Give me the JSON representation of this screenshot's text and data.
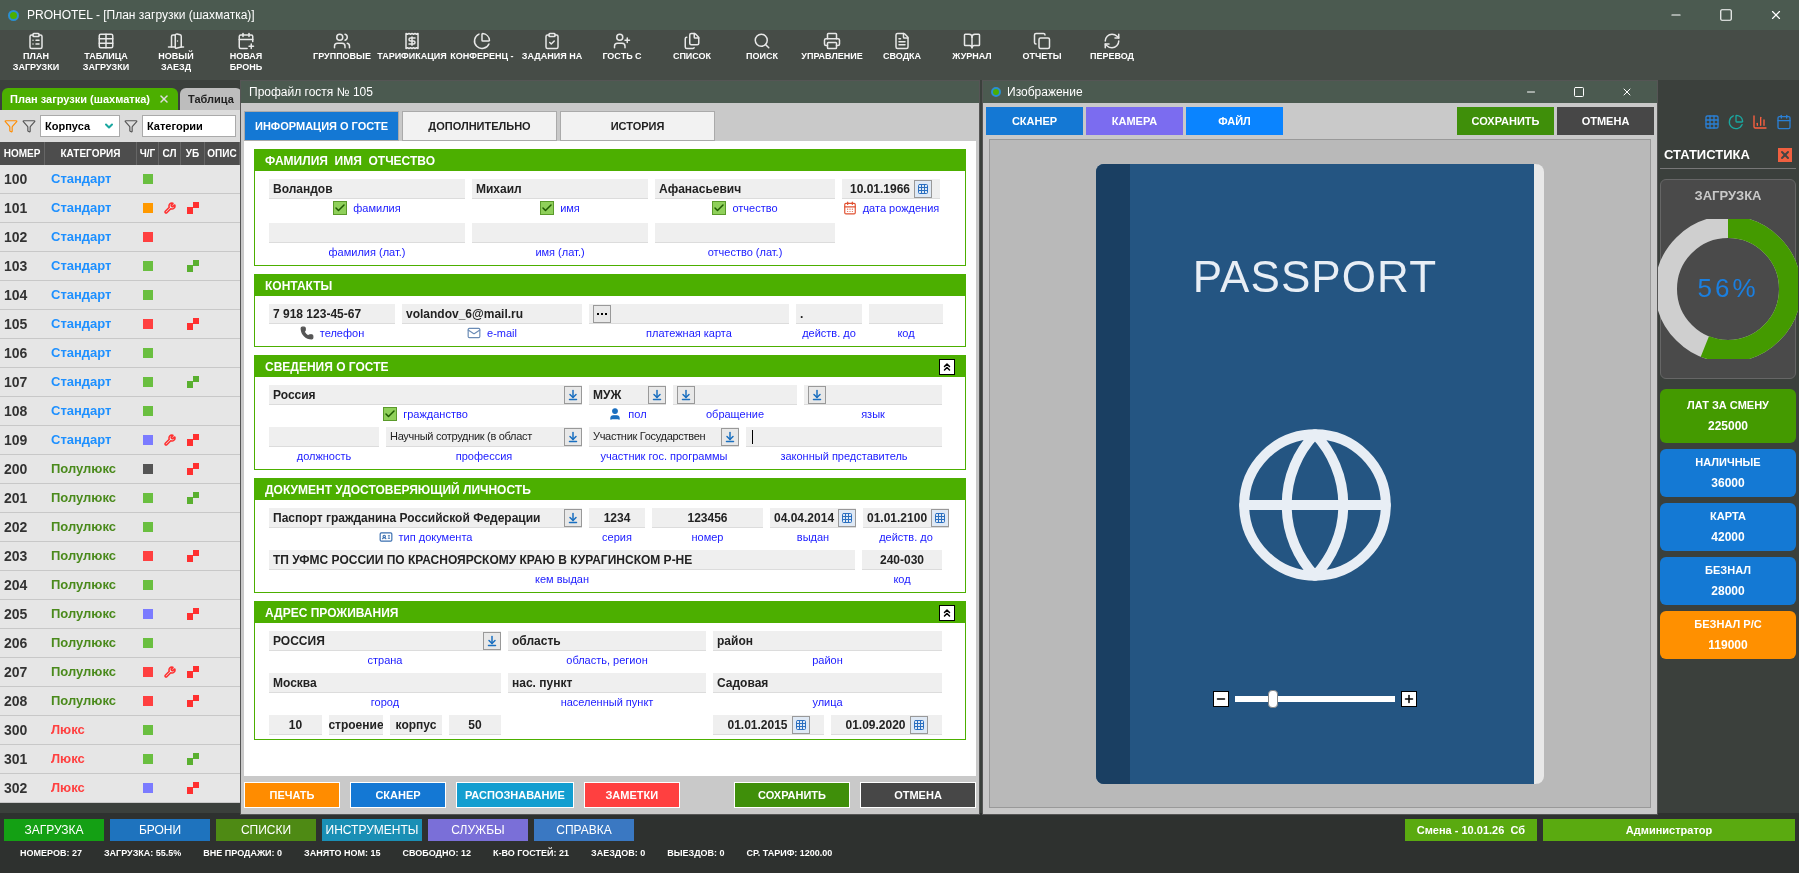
{
  "window": {
    "title": "PROHOTEL - [План загрузки (шахматка)]"
  },
  "toolbar": [
    {
      "lines": [
        "ПЛАН",
        "ЗАГРУЗКИ"
      ]
    },
    {
      "lines": [
        "ТАБЛИЦА",
        "ЗАГРУЗКИ"
      ]
    },
    {
      "lines": [
        "НОВЫЙ",
        "ЗАЕЗД"
      ]
    },
    {
      "lines": [
        "НОВАЯ",
        "БРОНЬ"
      ]
    },
    {
      "lines": [
        "ГРУППОВЫЕ"
      ]
    },
    {
      "lines": [
        "ТАРИФИКАЦИЯ"
      ]
    },
    {
      "lines": [
        "КОНФЕРЕНЦ -"
      ]
    },
    {
      "lines": [
        "ЗАДАНИЯ НА"
      ]
    },
    {
      "lines": [
        "ГОСТЬ С"
      ]
    },
    {
      "lines": [
        "СПИСОК"
      ]
    },
    {
      "lines": [
        "ПОИСК"
      ]
    },
    {
      "lines": [
        "УПРАВЛЕНИЕ"
      ]
    },
    {
      "lines": [
        "СВОДКА"
      ]
    },
    {
      "lines": [
        "ЖУРНАЛ"
      ]
    },
    {
      "lines": [
        "ОТЧЕТЫ"
      ]
    },
    {
      "lines": [
        "ПЕРЕВОД"
      ]
    }
  ],
  "main_tabs": [
    {
      "label": "План загрузки (шахматка)",
      "selected": true,
      "closable": true
    },
    {
      "label": "Таблица",
      "selected": false,
      "closable": false
    }
  ],
  "filters": [
    {
      "value": "Корпуса"
    },
    {
      "value": "Категории"
    }
  ],
  "table": {
    "columns": [
      "НОМЕР",
      "КАТЕГОРИЯ",
      "Ч/Г",
      "СЛ",
      "УБ",
      "ОПИС"
    ],
    "rows": [
      {
        "number": "100",
        "category": "Стандарт",
        "kind": "standard",
        "color": "#6abf40",
        "service": false
      },
      {
        "number": "101",
        "category": "Стандарт",
        "kind": "standard",
        "color": "#ff9900",
        "service": true,
        "cleaning": {
          "kind": "dirty"
        }
      },
      {
        "number": "102",
        "category": "Стандарт",
        "kind": "standard",
        "color": "#ff4040",
        "service": false
      },
      {
        "number": "103",
        "category": "Стандарт",
        "kind": "standard",
        "color": "#6abf40",
        "service": false,
        "cleaning": {
          "kind": "clean"
        }
      },
      {
        "number": "104",
        "category": "Стандарт",
        "kind": "standard",
        "color": "#6abf40",
        "service": false
      },
      {
        "number": "105",
        "category": "Стандарт",
        "kind": "standard",
        "color": "#ff4040",
        "service": false,
        "cleaning": {
          "kind": "dirty"
        }
      },
      {
        "number": "106",
        "category": "Стандарт",
        "kind": "standard",
        "color": "#6abf40",
        "service": false
      },
      {
        "number": "107",
        "category": "Стандарт",
        "kind": "standard",
        "color": "#6abf40",
        "service": false,
        "cleaning": {
          "kind": "clean"
        }
      },
      {
        "number": "108",
        "category": "Стандарт",
        "kind": "standard",
        "color": "#6abf40",
        "service": false
      },
      {
        "number": "109",
        "category": "Стандарт",
        "kind": "standard",
        "color": "#7b7bff",
        "service": true,
        "cleaning": {
          "kind": "dirty"
        }
      },
      {
        "number": "200",
        "category": "Полулюкс",
        "kind": "junior",
        "color": "#555555",
        "service": false,
        "cleaning": {
          "kind": "dirty"
        }
      },
      {
        "number": "201",
        "category": "Полулюкс",
        "kind": "junior",
        "color": "#6abf40",
        "service": false,
        "cleaning": {
          "kind": "clean"
        }
      },
      {
        "number": "202",
        "category": "Полулюкс",
        "kind": "junior",
        "color": "#6abf40",
        "service": false
      },
      {
        "number": "203",
        "category": "Полулюкс",
        "kind": "junior",
        "color": "#ff4040",
        "service": false,
        "cleaning": {
          "kind": "dirty"
        }
      },
      {
        "number": "204",
        "category": "Полулюкс",
        "kind": "junior",
        "color": "#6abf40",
        "service": false
      },
      {
        "number": "205",
        "category": "Полулюкс",
        "kind": "junior",
        "color": "#7b7bff",
        "service": false,
        "cleaning": {
          "kind": "dirty"
        }
      },
      {
        "number": "206",
        "category": "Полулюкс",
        "kind": "junior",
        "color": "#6abf40",
        "service": false
      },
      {
        "number": "207",
        "category": "Полулюкс",
        "kind": "junior",
        "color": "#ff4040",
        "service": true,
        "cleaning": {
          "kind": "dirty"
        }
      },
      {
        "number": "208",
        "category": "Полулюкс",
        "kind": "junior",
        "color": "#ff4040",
        "service": false,
        "cleaning": {
          "kind": "dirty"
        }
      },
      {
        "number": "300",
        "category": "Люкс",
        "kind": "suite",
        "color": "#6abf40",
        "service": false
      },
      {
        "number": "301",
        "category": "Люкс",
        "kind": "suite",
        "color": "#6abf40",
        "service": false,
        "cleaning": {
          "kind": "clean"
        }
      },
      {
        "number": "302",
        "category": "Люкс",
        "kind": "suite",
        "color": "#7b7bff",
        "service": false,
        "cleaning": {
          "kind": "dirty"
        }
      }
    ]
  },
  "profile": {
    "title": "Профайл гостя № 105",
    "tabs": [
      {
        "label": "ИНФОРМАЦИЯ О ГОСТЕ",
        "selected": true
      },
      {
        "label": "ДОПОЛНИТЕЛЬНО",
        "selected": false
      },
      {
        "label": "ИСТОРИЯ",
        "selected": false
      }
    ],
    "fio": {
      "title": "ФАМИЛИЯ  ИМЯ  ОТЧЕСТВО",
      "collapsible": false,
      "names": [
        {
          "value": "Воландов",
          "label": "фамилия",
          "checked": true
        },
        {
          "value": "Михаил",
          "label": "имя",
          "checked": true
        },
        {
          "value": "Афанасьевич",
          "label": "отчество",
          "checked": true
        }
      ],
      "birth": {
        "value": "10.01.1966",
        "label": "дата рождения"
      },
      "latin": [
        {
          "label": "фамилия (лат.)"
        },
        {
          "label": "имя (лат.)"
        },
        {
          "label": "отчество (лат.)"
        }
      ]
    },
    "contacts": {
      "title": "КОНТАКТЫ",
      "collapsible": false,
      "phone": {
        "value": "7 918 123-45-67",
        "label": "телефон"
      },
      "email": {
        "value": "volandov_6@mail.ru",
        "label": "e-mail"
      },
      "card": {
        "label": "платежная карта"
      },
      "valid": {
        "value": ".",
        "label": "действ. до"
      },
      "code": {
        "label": "код"
      }
    },
    "guest": {
      "title": "СВЕДЕНИЯ О ГОСТЕ",
      "collapsible": true,
      "citizenship": {
        "value": "Россия",
        "label": "гражданство",
        "checked": true
      },
      "gender": {
        "value": "МУЖ",
        "label": "пол"
      },
      "salutation": {
        "label": "обращение"
      },
      "language": {
        "label": "язык"
      },
      "position": {
        "label": "должность"
      },
      "profession": {
        "value": "Научный сотрудник (в област",
        "label": "профессия"
      },
      "program": {
        "value": "Участник Государствен",
        "label": "участник гос. программы"
      },
      "representative": {
        "label": "законный представитель"
      }
    },
    "document": {
      "title": "ДОКУМЕНТ УДОСТОВЕРЯЮЩИЙ ЛИЧНОСТЬ",
      "collapsible": false,
      "type": {
        "value": "Паспорт гражданина Российской Федерации",
        "label": "тип документа"
      },
      "series": {
        "value": "1234",
        "label": "серия"
      },
      "number": {
        "value": "123456",
        "label": "номер"
      },
      "issued": {
        "value": "04.04.2014",
        "label": "выдан"
      },
      "valid": {
        "value": "01.01.2100",
        "label": "действ. до"
      },
      "issued_by": {
        "value": "ТП УФМС РОССИИ ПО КРАСНОЯРСКОМУ КРАЮ В КУРАГИНСКОМ Р-НЕ",
        "label": "кем выдан"
      },
      "code": {
        "value": "240-030",
        "label": "код"
      }
    },
    "address": {
      "title": "АДРЕС ПРОЖИВАНИЯ",
      "collapsible": true,
      "country": {
        "value": "РОССИЯ",
        "label": "страна"
      },
      "region": {
        "value": "область",
        "label": "область, регион"
      },
      "district": {
        "value": "район",
        "label": "район"
      },
      "city": {
        "value": "Москва",
        "label": "город"
      },
      "locality": {
        "value": "нас. пункт",
        "label": "населенный пункт"
      },
      "street": {
        "value": "Садовая",
        "label": "улица"
      },
      "house": {
        "value": "10"
      },
      "building": {
        "value": "строение"
      },
      "block": {
        "value": "корпус"
      },
      "flat": {
        "value": "50"
      },
      "date_from": {
        "value": "01.01.2015"
      },
      "date_to": {
        "value": "01.09.2020"
      }
    },
    "buttons": [
      {
        "label": "ПЕЧАТЬ",
        "color": "#ff8c00"
      },
      {
        "label": "СКАНЕР",
        "color": "#1478d4"
      },
      {
        "label": "РАСПОЗНАВАНИЕ",
        "color": "#139ed0"
      },
      {
        "label": "ЗАМЕТКИ",
        "color": "#ff4040"
      }
    ],
    "actions": [
      {
        "label": "СОХРАНИТЬ",
        "color": "#3f8f0a"
      },
      {
        "label": "ОТМЕНА",
        "color": "#474747"
      }
    ]
  },
  "image": {
    "title": "Изображение",
    "sources": [
      {
        "label": "СКАНЕР",
        "color": "#1478d4"
      },
      {
        "label": "КАМЕРА",
        "color": "#7b6cf0"
      },
      {
        "label": "ФАЙЛ",
        "color": "#0a84ff"
      }
    ],
    "actions": [
      {
        "label": "СОХРАНИТЬ",
        "color": "#3f8f0a"
      },
      {
        "label": "ОТМЕНА",
        "color": "#474747"
      }
    ],
    "passport": {
      "title": "PASSPORT"
    },
    "zoom": {
      "level": 0.22
    }
  },
  "stats": {
    "title": "СТАТИСТИКА",
    "load": {
      "title": "ЗАГРУЗКА",
      "level": 0.56,
      "reading": "56%"
    },
    "cards": [
      {
        "label": "ЛАТ ЗА СМЕНУ",
        "value": "225000",
        "color": "#449a00"
      },
      {
        "label": "НАЛИЧНЫЕ",
        "value": "36000",
        "color": "#1479d4"
      },
      {
        "label": "КАРТА",
        "value": "42000",
        "color": "#1479d4"
      },
      {
        "label": "БЕЗНАЛ",
        "value": "28000",
        "color": "#1479d4"
      },
      {
        "label": "БЕЗНАЛ Р/С",
        "value": "119000",
        "color": "#ff9000"
      }
    ]
  },
  "nav": [
    {
      "label": "ЗАГРУЗКА",
      "color": "#14a014"
    },
    {
      "label": "БРОНИ",
      "color": "#1e73be"
    },
    {
      "label": "СПИСКИ",
      "color": "#4e8a14"
    },
    {
      "label": "ИНСТРУМЕНТЫ",
      "color": "#1a8fb5"
    },
    {
      "label": "СЛУЖБЫ",
      "color": "#7a6fd8"
    },
    {
      "label": "СПРАВКА",
      "color": "#3a78c2"
    }
  ],
  "shift": "Смена - 10.01.26  Сб",
  "user": "Администратор",
  "status_bar": [
    "НОМЕРОВ: 27",
    "ЗАГРУЗКА: 55.5%",
    "ВНЕ ПРОДАЖИ: 0",
    "ЗАНЯТО НОМ: 15",
    "СВОБОДНО: 12",
    "К-ВО ГОСТЕЙ: 21",
    "ЗАЕЗДОВ: 0",
    "ВЫЕЗДОВ: 0",
    "СР. ТАРИФ: 1200.00"
  ]
}
